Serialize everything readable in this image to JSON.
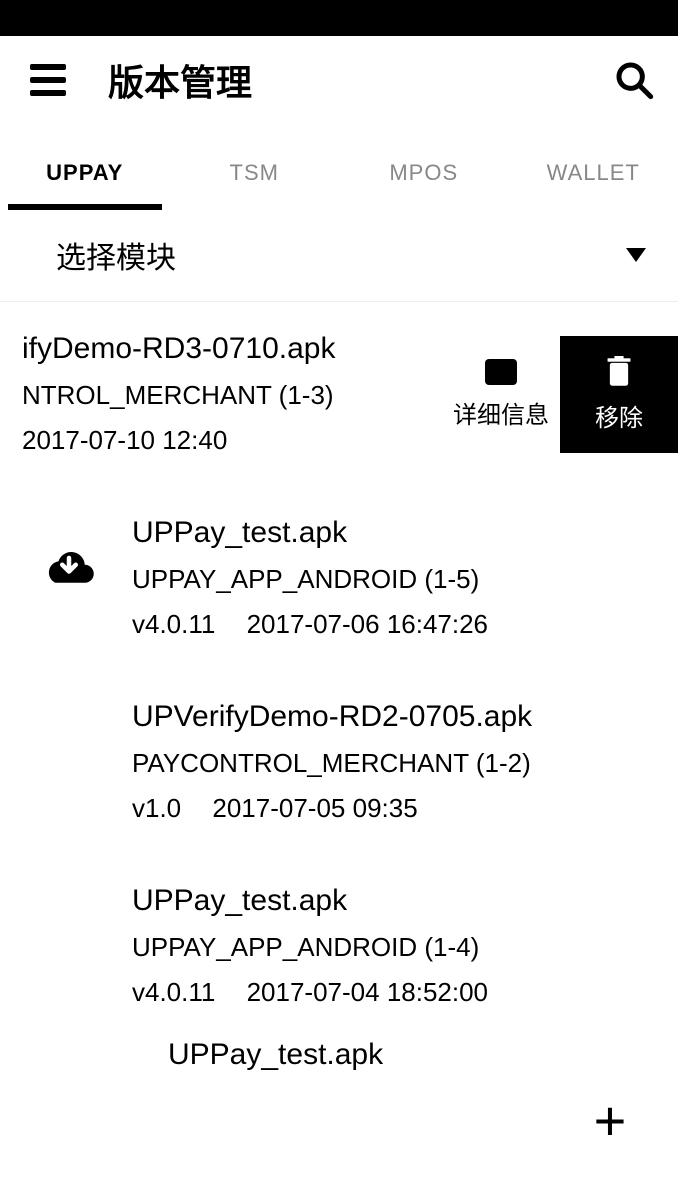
{
  "header": {
    "title": "版本管理"
  },
  "tabs": [
    {
      "label": "UPPAY",
      "active": true
    },
    {
      "label": "TSM",
      "active": false
    },
    {
      "label": "MPOS",
      "active": false
    },
    {
      "label": "WALLET",
      "active": false
    }
  ],
  "module_selector": {
    "label": "选择模块"
  },
  "swipe_actions": {
    "details_label": "详细信息",
    "remove_label": "移除"
  },
  "items": [
    {
      "swiped": true,
      "filename": "ifyDemo-RD3-0710.apk",
      "module": "NTROL_MERCHANT (1-3)",
      "version": "",
      "timestamp": "2017-07-10 12:40",
      "has_download_icon": false
    },
    {
      "swiped": false,
      "filename": "UPPay_test.apk",
      "module": "UPPAY_APP_ANDROID (1-5)",
      "version": "v4.0.11",
      "timestamp": "2017-07-06 16:47:26",
      "has_download_icon": true
    },
    {
      "swiped": false,
      "filename": "UPVerifyDemo-RD2-0705.apk",
      "module": "PAYCONTROL_MERCHANT (1-2)",
      "version": "v1.0",
      "timestamp": "2017-07-05 09:35",
      "has_download_icon": false
    },
    {
      "swiped": false,
      "filename": "UPPay_test.apk",
      "module": "UPPAY_APP_ANDROID (1-4)",
      "version": "v4.0.11",
      "timestamp": "2017-07-04 18:52:00",
      "has_download_icon": false
    }
  ],
  "cutoff_item": {
    "filename": "UPPay_test.apk"
  }
}
